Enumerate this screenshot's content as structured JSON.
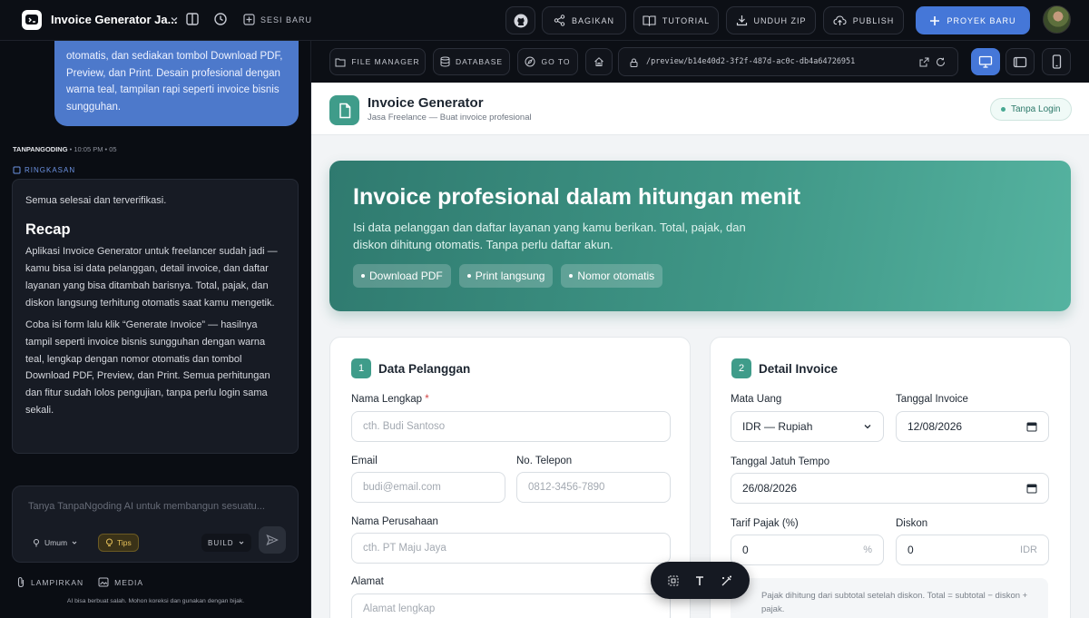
{
  "topbar": {
    "project_title": "Invoice Generator Ja...",
    "new_session": "SESI BARU",
    "share": "BAGIKAN",
    "tutorial": "TUTORIAL",
    "download_zip": "UNDUH ZIP",
    "publish": "PUBLISH",
    "new_project": "PROYEK BARU"
  },
  "chat": {
    "user_message_tail": "otomatis, dan sediakan tombol Download PDF, Preview, dan Print. Desain profesional dengan warna teal, tampilan rapi seperti invoice bisnis sungguhan.",
    "sender": "TANPANGODING",
    "time": "• 10:05 PM • 05",
    "summary_label": "RINGKASAN",
    "summary_intro": "Semua selesai dan terverifikasi.",
    "recap_title": "Recap",
    "recap_p1": "Aplikasi Invoice Generator untuk freelancer sudah jadi — kamu bisa isi data pelanggan, detail invoice, dan daftar layanan yang bisa ditambah barisnya. Total, pajak, dan diskon langsung terhitung otomatis saat kamu mengetik.",
    "recap_p2": "Coba isi form lalu klik “Generate Invoice” — hasilnya tampil seperti invoice bisnis sungguhan dengan warna teal, lengkap dengan nomor otomatis dan tombol Download PDF, Preview, dan Print. Semua perhitungan dan fitur sudah lolos pengujian, tanpa perlu login sama sekali.",
    "input_placeholder": "Tanya TanpaNgoding AI untuk membangun sesuatu...",
    "mode_chip": "Umum",
    "tips_chip": "Tips",
    "build_chip": "BUILD",
    "attach": "LAMPIRKAN",
    "media": "MEDIA",
    "disclaimer": "AI bisa berbuat salah. Mohon koreksi dan gunakan dengan bijak."
  },
  "toolbar": {
    "file_manager": "FILE MANAGER",
    "database": "DATABASE",
    "go_to": "GO TO",
    "url": "/preview/b14e40d2-3f2f-487d-ac0c-db4a64726951"
  },
  "preview": {
    "app_title": "Invoice Generator",
    "app_subtitle": "Jasa Freelance — Buat invoice profesional",
    "login_badge": "Tanpa Login",
    "hero_title": "Invoice profesional dalam hitungan menit",
    "hero_desc": "Isi data pelanggan dan daftar layanan yang kamu berikan. Total, pajak, dan diskon dihitung otomatis. Tanpa perlu daftar akun.",
    "hero_tags": [
      "Download PDF",
      "Print langsung",
      "Nomor otomatis"
    ],
    "customer": {
      "step": "1",
      "title": "Data Pelanggan",
      "name_label": "Nama Lengkap",
      "required_mark": "*",
      "name_placeholder": "cth. Budi Santoso",
      "email_label": "Email",
      "email_placeholder": "budi@email.com",
      "phone_label": "No. Telepon",
      "phone_placeholder": "0812-3456-7890",
      "company_label": "Nama Perusahaan",
      "company_placeholder": "cth. PT Maju Jaya",
      "address_label": "Alamat",
      "address_placeholder": "Alamat lengkap"
    },
    "invoice": {
      "step": "2",
      "title": "Detail Invoice",
      "currency_label": "Mata Uang",
      "currency_value": "IDR — Rupiah",
      "date_label": "Tanggal Invoice",
      "date_value": "12/08/2026",
      "due_label": "Tanggal Jatuh Tempo",
      "due_value": "26/08/2026",
      "tax_label": "Tarif Pajak (%)",
      "tax_value": "0",
      "tax_suffix": "%",
      "discount_label": "Diskon",
      "discount_value": "0",
      "discount_suffix": "IDR",
      "note": "Pajak dihitung dari subtotal setelah diskon. Total = subtotal − diskon + pajak."
    }
  },
  "colors": {
    "accent_blue": "#4577d8",
    "teal": "#3f9c8a",
    "dark_bg": "#0a0d13"
  }
}
